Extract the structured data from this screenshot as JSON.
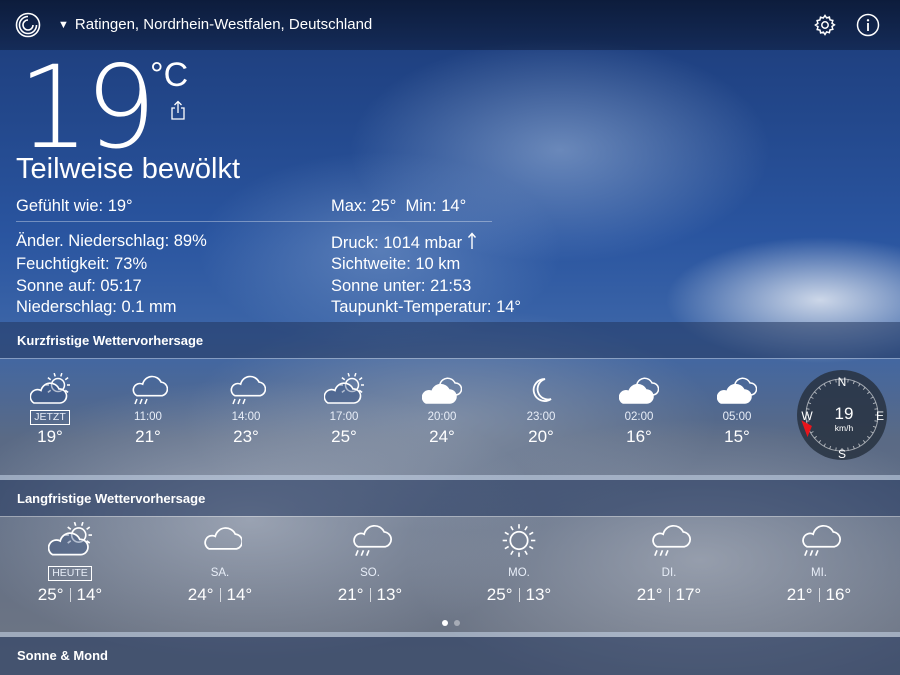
{
  "header": {
    "location": "Ratingen, Nordrhein-Westfalen, Deutschland",
    "logo_icon": "wetter-logo-icon",
    "settings_icon": "gear-icon",
    "info_icon": "info-icon"
  },
  "current": {
    "temp": "19",
    "unit": "°C",
    "condition": "Teilweise bewölkt",
    "feels_like": "Gefühlt wie: 19°",
    "max_min": "Max: 25°  Min: 14°",
    "precip_chance": "Änder. Niederschlag: 89%",
    "humidity": "Feuchtigkeit: 73%",
    "sunrise": "Sonne auf: 05:17",
    "precipitation": "Niederschlag: 0.1 mm",
    "pressure": "Druck: 1014 mbar",
    "visibility": "Sichtweite: 10 km",
    "sunset": "Sonne unter: 21:53",
    "dewpoint": "Taupunkt-Temperatur: 14°"
  },
  "short_term": {
    "title": "Kurzfristige Wettervorhersage",
    "hours": [
      {
        "time": "JETZT",
        "temp": "19°",
        "icon": "partly-cloudy-day-icon"
      },
      {
        "time": "11:00",
        "temp": "21°",
        "icon": "cloud-rain-icon"
      },
      {
        "time": "14:00",
        "temp": "23°",
        "icon": "cloud-rain-icon"
      },
      {
        "time": "17:00",
        "temp": "25°",
        "icon": "partly-cloudy-day-icon"
      },
      {
        "time": "20:00",
        "temp": "24°",
        "icon": "cloudy-icon"
      },
      {
        "time": "23:00",
        "temp": "20°",
        "icon": "moon-icon"
      },
      {
        "time": "02:00",
        "temp": "16°",
        "icon": "cloudy-icon"
      },
      {
        "time": "05:00",
        "temp": "15°",
        "icon": "cloudy-icon"
      }
    ],
    "wind": {
      "speed": "19",
      "unit": "km/h",
      "n": "N",
      "e": "E",
      "s": "S",
      "w": "W",
      "direction_deg": 250,
      "accent": "#e8151b"
    }
  },
  "long_term": {
    "title": "Langfristige Wettervorhersage",
    "days": [
      {
        "name": "HEUTE",
        "max": "25°",
        "min": "14°",
        "icon": "partly-cloudy-day-icon"
      },
      {
        "name": "SA.",
        "max": "24°",
        "min": "14°",
        "icon": "cloud-icon"
      },
      {
        "name": "SO.",
        "max": "21°",
        "min": "13°",
        "icon": "cloud-rain-icon"
      },
      {
        "name": "MO.",
        "max": "25°",
        "min": "13°",
        "icon": "sun-icon"
      },
      {
        "name": "DI.",
        "max": "21°",
        "min": "17°",
        "icon": "cloud-rain-icon"
      },
      {
        "name": "MI.",
        "max": "21°",
        "min": "16°",
        "icon": "cloud-rain-icon"
      }
    ],
    "pager": {
      "count": 2,
      "active": 0
    }
  },
  "sun_moon": {
    "title": "Sonne & Mond"
  }
}
